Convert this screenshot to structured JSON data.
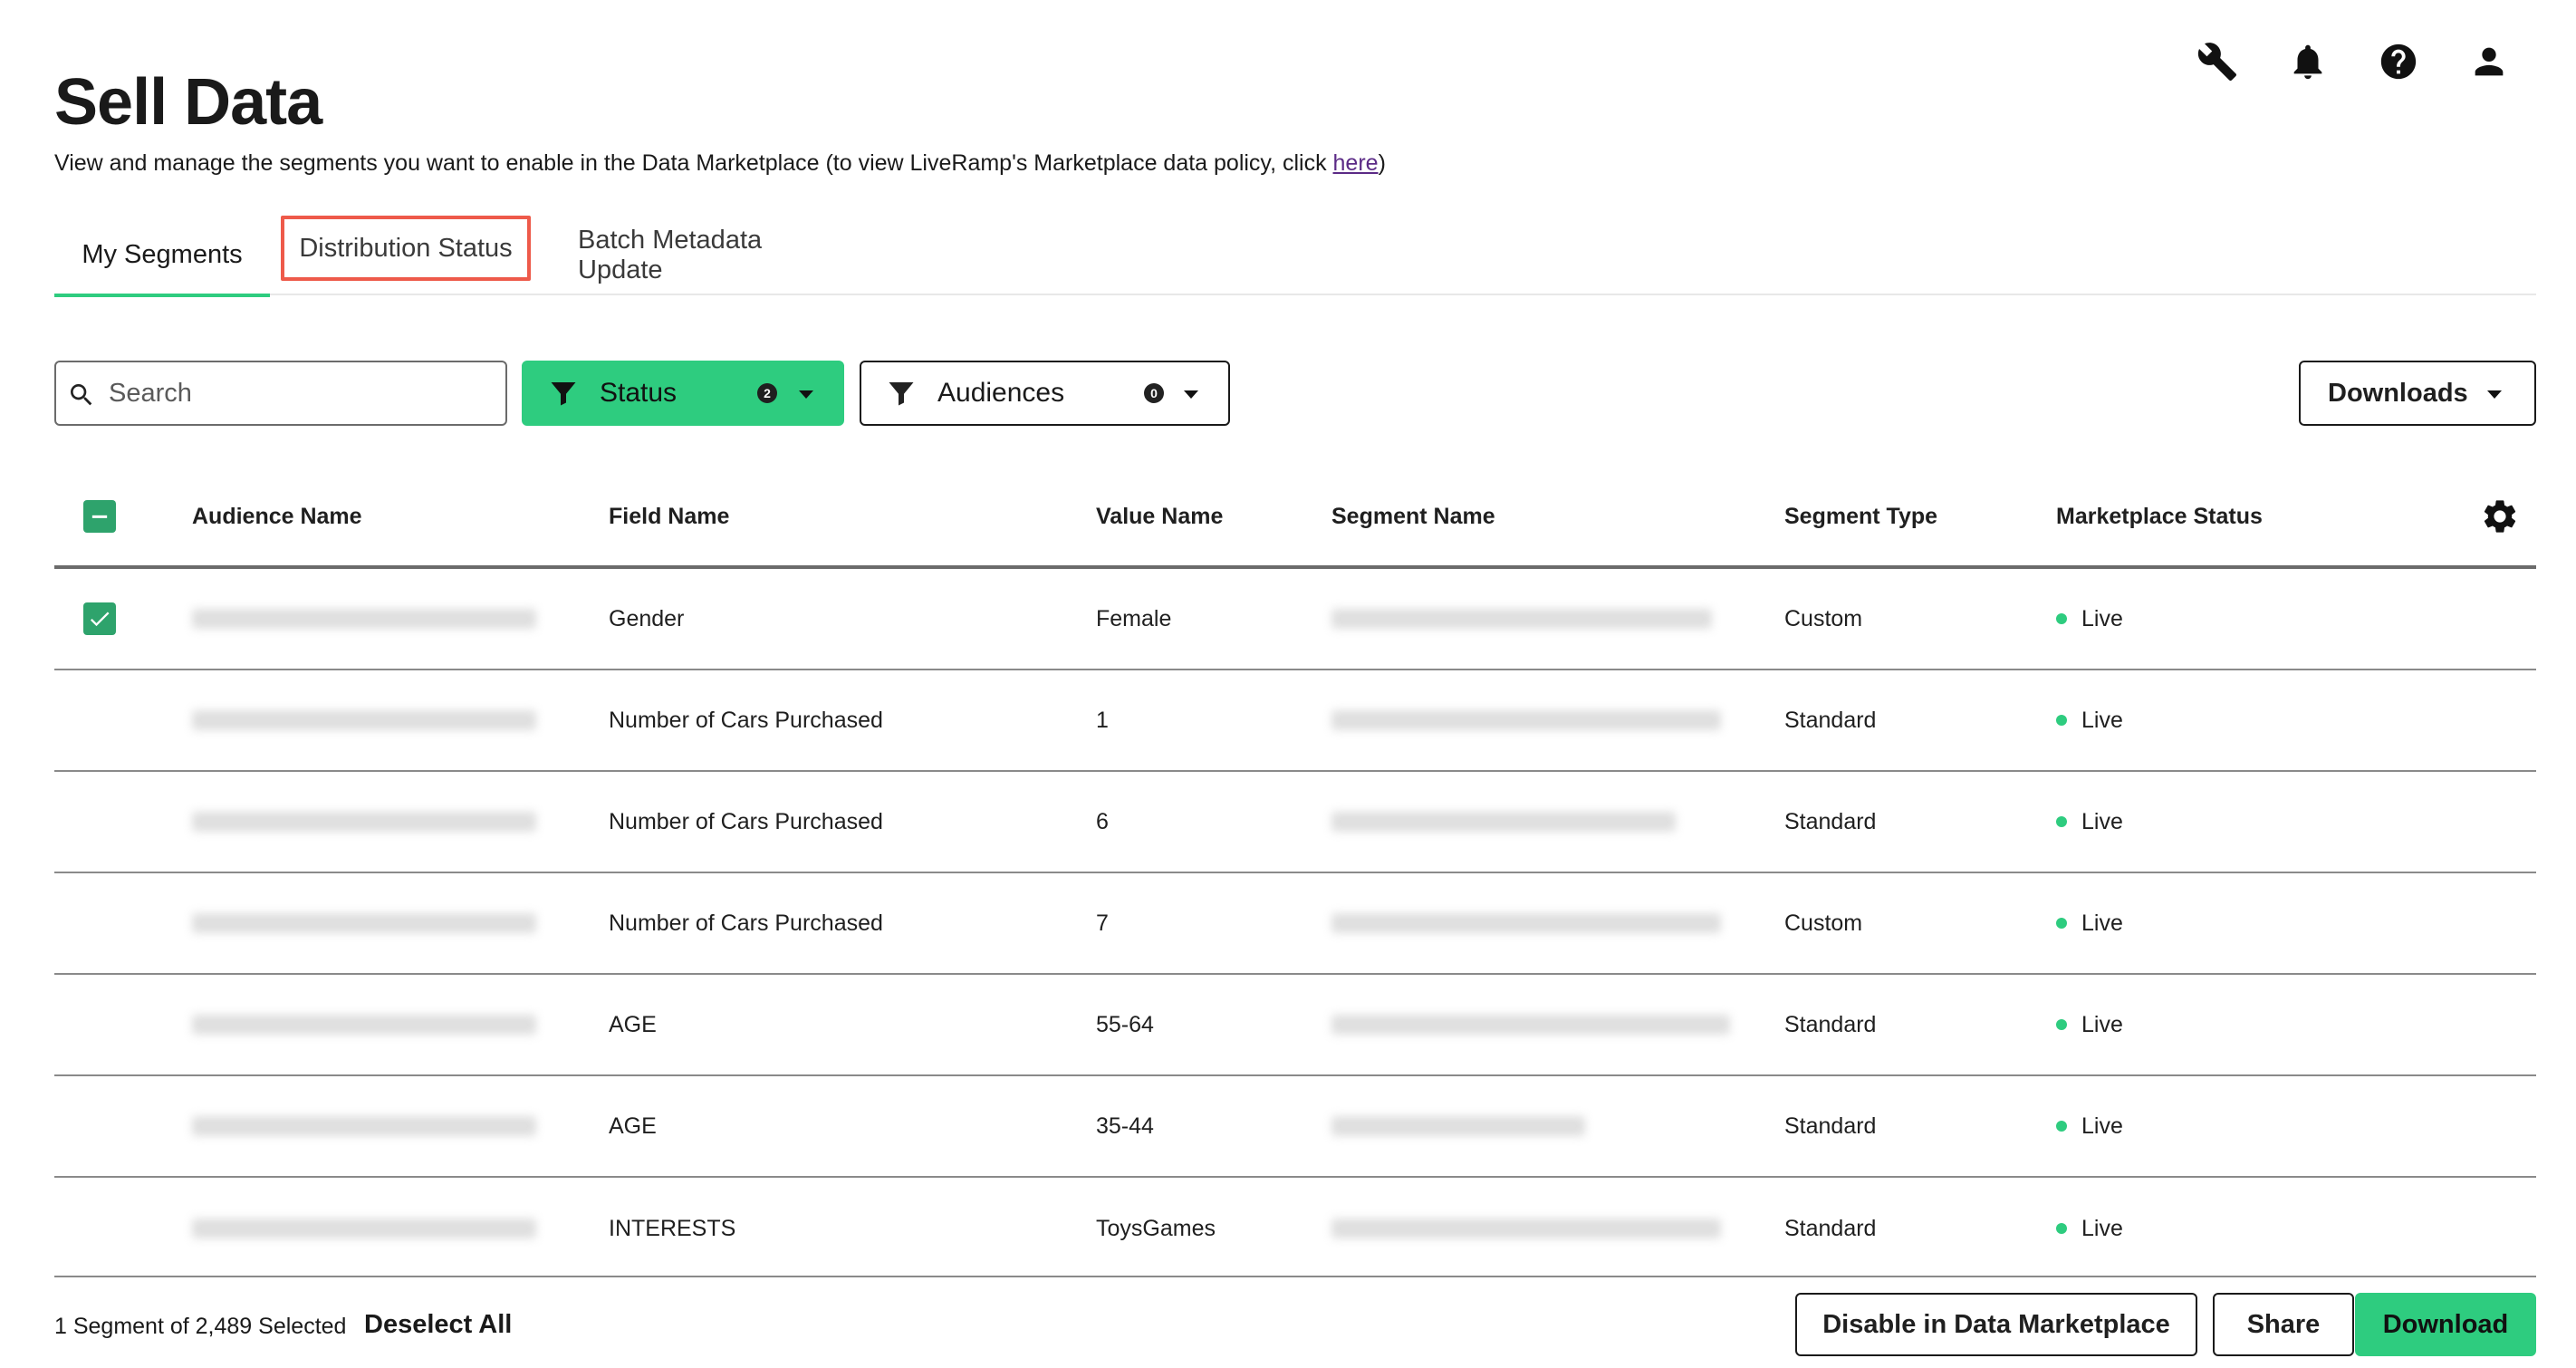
{
  "header": {
    "title": "Sell Data",
    "subtitle_pre": "View and manage the segments you want to enable in the Data Marketplace (to view LiveRamp's Marketplace data policy, click ",
    "subtitle_link": "here",
    "subtitle_post": ")",
    "icons": [
      "wrench-icon",
      "bell-icon",
      "help-icon",
      "user-icon"
    ]
  },
  "tabs": [
    {
      "label": "My Segments",
      "active": true
    },
    {
      "label": "Distribution Status",
      "active": false,
      "highlighted": true
    },
    {
      "label": "Batch Metadata Update",
      "active": false
    }
  ],
  "toolbar": {
    "search_placeholder": "Search",
    "status_filter": {
      "label": "Status",
      "count": "2"
    },
    "audiences_filter": {
      "label": "Audiences",
      "count": "0"
    },
    "downloads_label": "Downloads"
  },
  "table": {
    "columns": [
      "Audience Name",
      "Field Name",
      "Value Name",
      "Segment Name",
      "Segment Type",
      "Marketplace Status"
    ],
    "rows": [
      {
        "checked": true,
        "field": "Gender",
        "value": "Female",
        "type": "Custom",
        "status": "Live"
      },
      {
        "checked": false,
        "field": "Number of Cars Purchased",
        "value": "1",
        "type": "Standard",
        "status": "Live"
      },
      {
        "checked": false,
        "field": "Number of Cars Purchased",
        "value": "6",
        "type": "Standard",
        "status": "Live"
      },
      {
        "checked": false,
        "field": "Number of Cars Purchased",
        "value": "7",
        "type": "Custom",
        "status": "Live"
      },
      {
        "checked": false,
        "field": "AGE",
        "value": "55-64",
        "type": "Standard",
        "status": "Live"
      },
      {
        "checked": false,
        "field": "AGE",
        "value": "35-44",
        "type": "Standard",
        "status": "Live"
      },
      {
        "checked": false,
        "field": "INTERESTS",
        "value": "ToysGames",
        "type": "Standard",
        "status": "Live"
      }
    ]
  },
  "footer": {
    "selection_text": "1 Segment of 2,489 Selected",
    "deselect_label": "Deselect All",
    "disable_label": "Disable in Data Marketplace",
    "share_label": "Share",
    "download_label": "Download"
  },
  "colors": {
    "accent_green": "#2ecc7f",
    "checkbox_green": "#2ea36c",
    "highlight_red": "#ee5a4a",
    "link_purple": "#5b2a86"
  }
}
